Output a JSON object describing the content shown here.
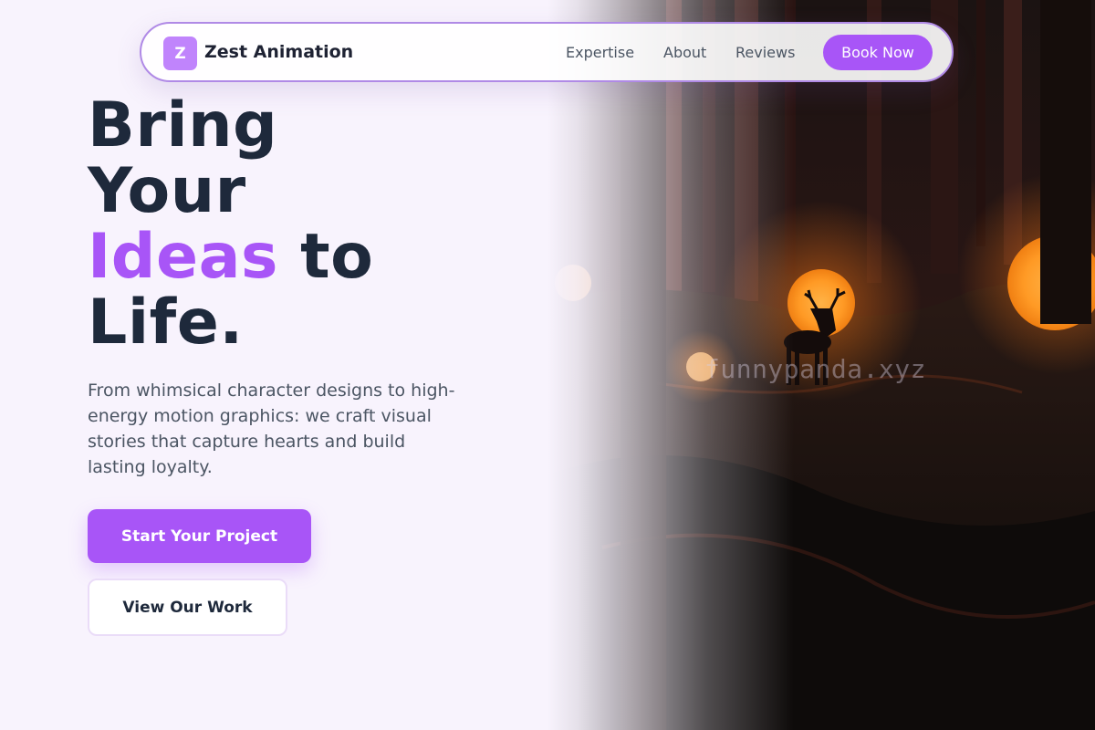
{
  "nav": {
    "logo_letter": "Z",
    "brand": "Zest Animation",
    "links": [
      "Expertise",
      "About",
      "Reviews"
    ],
    "cta": "Book Now"
  },
  "hero": {
    "headline_line1": "Bring",
    "headline_line2": "Your",
    "headline_accent": "Ideas",
    "headline_line3_rest": " to",
    "headline_line4": "Life.",
    "subtext": "From whimsical character designs to high-energy motion graphics: we craft visual stories that capture hearts and build lasting loyalty.",
    "primary_button": "Start Your Project",
    "secondary_button": "View Our Work"
  },
  "image": {
    "watermark": "funnypanda.xyz",
    "subject_icon": "deer-silhouette-icon"
  },
  "colors": {
    "accent": "#a855f7",
    "logo_bg": "#c084fc",
    "page_bg": "#f8f3fd",
    "heading": "#1e293b",
    "body_text": "#4b5563",
    "nav_border": "#b08ae6",
    "orb_glow": "#ff8a1e"
  }
}
